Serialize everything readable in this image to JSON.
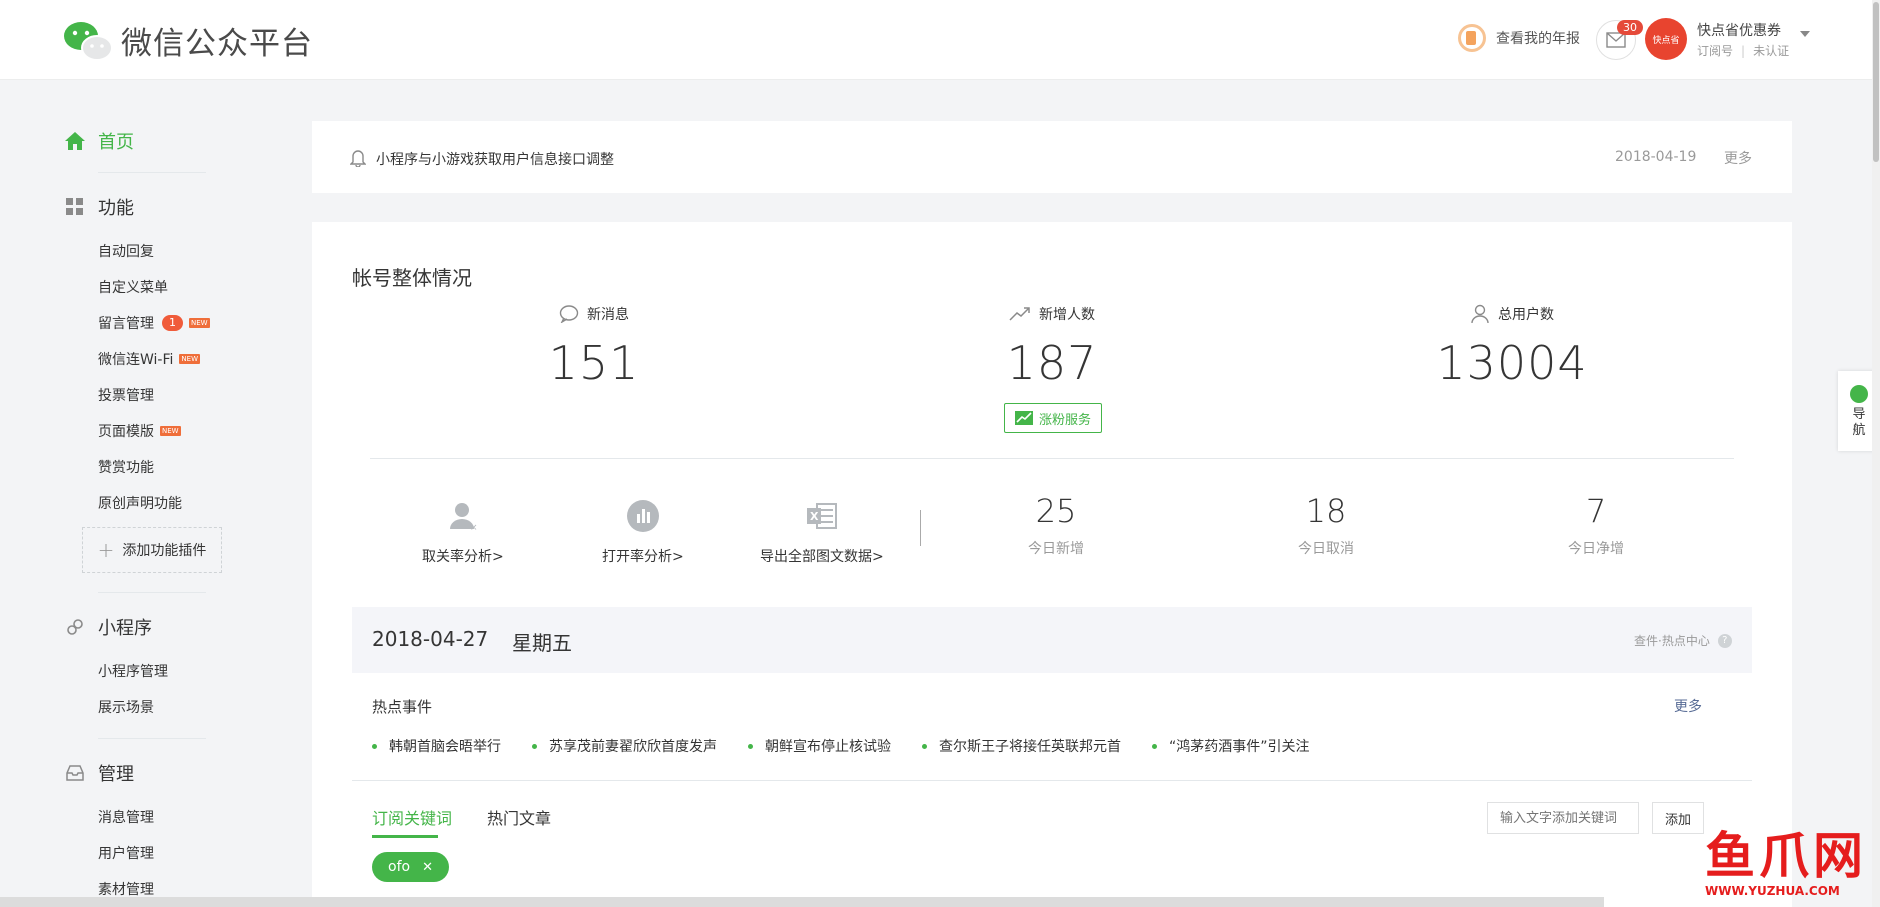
{
  "header": {
    "logo_text": "微信公众平台",
    "annual_report": "查看我的年报",
    "mail_count": "30",
    "account": {
      "avatar_text": "快点省",
      "name": "快点省优惠券",
      "type": "订阅号",
      "verify": "未认证"
    }
  },
  "sidebar": {
    "home": "首页",
    "functions": {
      "title": "功能",
      "items": [
        {
          "label": "自动回复"
        },
        {
          "label": "自定义菜单"
        },
        {
          "label": "留言管理",
          "count": "1",
          "new": "NEW"
        },
        {
          "label": "微信连Wi-Fi",
          "new": "NEW"
        },
        {
          "label": "投票管理"
        },
        {
          "label": "页面模版",
          "new": "NEW"
        },
        {
          "label": "赞赏功能"
        },
        {
          "label": "原创声明功能"
        }
      ],
      "add_plugin": "添加功能插件"
    },
    "miniprogram": {
      "title": "小程序",
      "items": [
        {
          "label": "小程序管理"
        },
        {
          "label": "展示场景"
        }
      ]
    },
    "manage": {
      "title": "管理",
      "items": [
        {
          "label": "消息管理"
        },
        {
          "label": "用户管理"
        },
        {
          "label": "素材管理"
        }
      ]
    }
  },
  "notice": {
    "text": "小程序与小游戏获取用户信息接口调整",
    "date": "2018-04-19",
    "more": "更多"
  },
  "overview": {
    "title": "帐号整体情况",
    "stats": [
      {
        "label": "新消息",
        "value": "151"
      },
      {
        "label": "新增人数",
        "value": "187"
      },
      {
        "label": "总用户数",
        "value": "13004"
      }
    ],
    "grow_button": "涨粉服务",
    "tools": [
      {
        "label": "取关率分析>"
      },
      {
        "label": "打开率分析>"
      },
      {
        "label": "导出全部图文数据>"
      }
    ],
    "today": [
      {
        "value": "25",
        "label": "今日新增"
      },
      {
        "value": "18",
        "label": "今日取消"
      },
      {
        "value": "7",
        "label": "今日净增"
      }
    ]
  },
  "hot": {
    "date": "2018-04-27",
    "weekday": "星期五",
    "center_label": "查件·热点中心",
    "title": "热点事件",
    "more": "更多",
    "events": [
      "韩朝首脑会晤举行",
      "苏享茂前妻翟欣欣首度发声",
      "朝鲜宣布停止核试验",
      "查尔斯王子将接任英联邦元首",
      "“鸿茅药酒事件”引关注"
    ]
  },
  "keywords": {
    "tabs": [
      "订阅关键词",
      "热门文章"
    ],
    "input_placeholder": "输入文字添加关键词",
    "add_button": "添加",
    "tags": [
      "ofo"
    ]
  },
  "guide": {
    "label_1": "导",
    "label_2": "航"
  },
  "watermark": {
    "big": "鱼爪网",
    "small": "WWW.YUZHUA.COM"
  }
}
